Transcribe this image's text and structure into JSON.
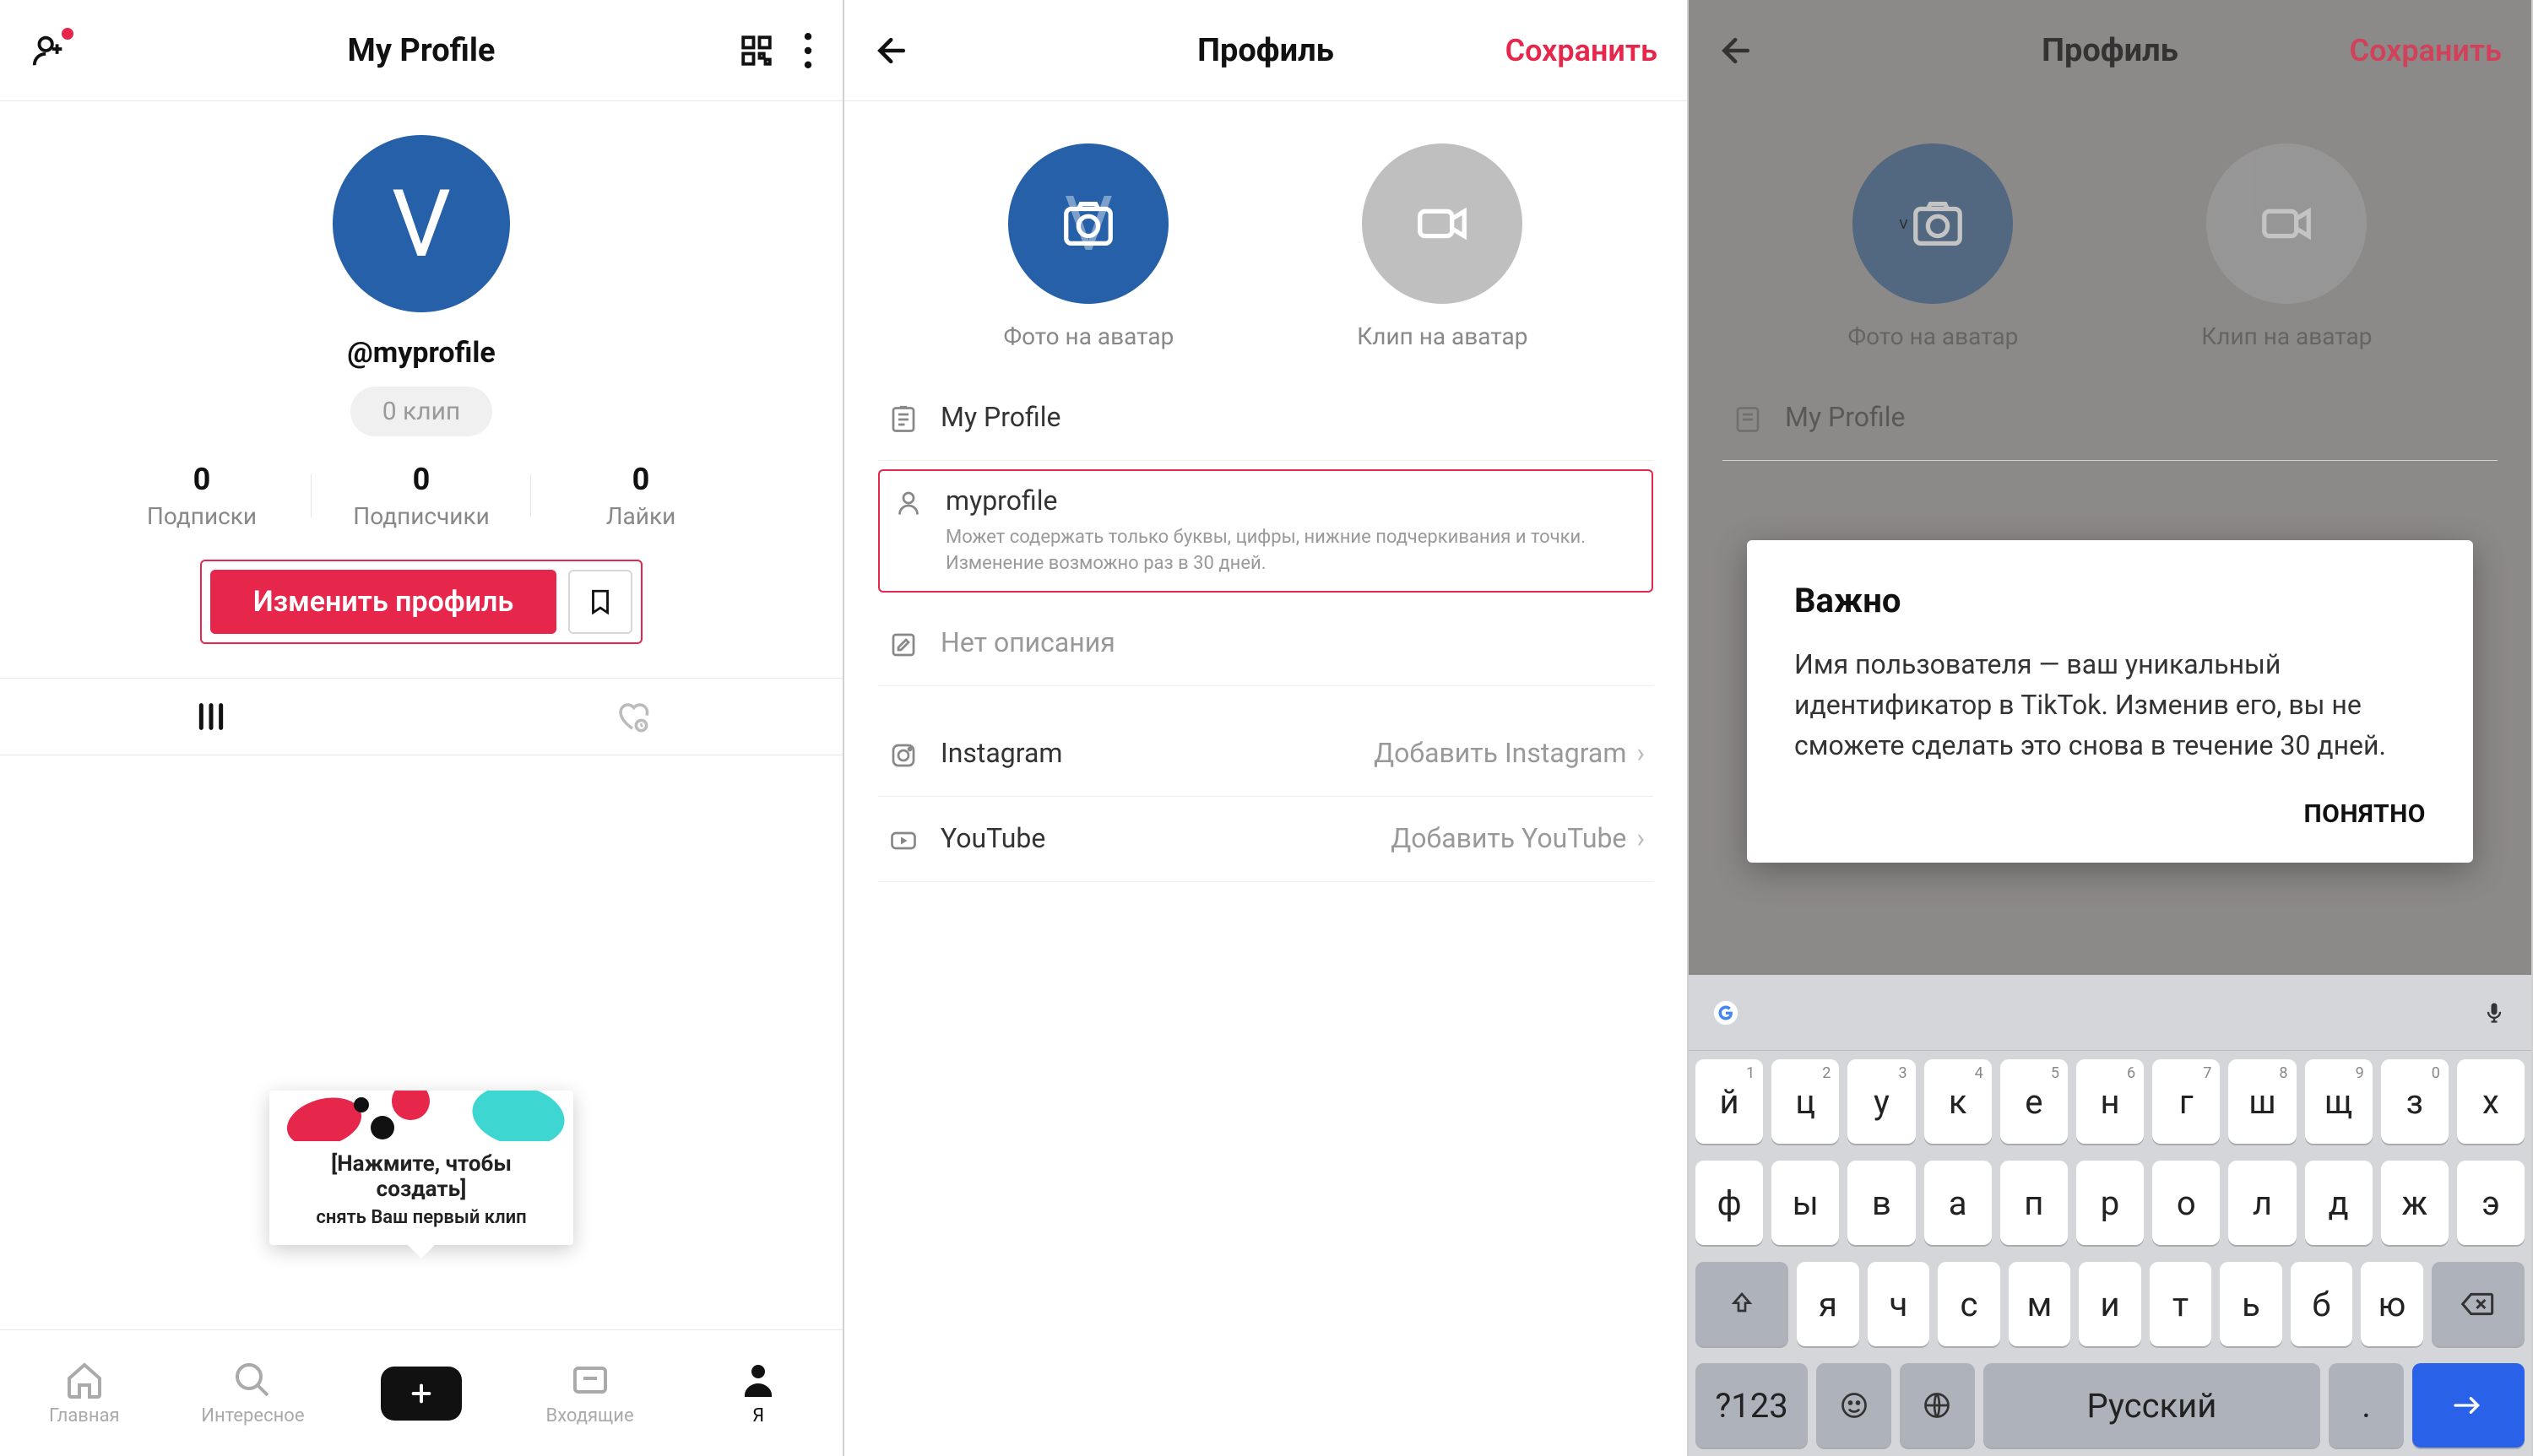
{
  "panel1": {
    "header": {
      "title": "My Profile"
    },
    "username": "@myprofile",
    "clip_pill": "0 клип",
    "stats": [
      {
        "n": "0",
        "l": "Подписки"
      },
      {
        "n": "0",
        "l": "Подписчики"
      },
      {
        "n": "0",
        "l": "Лайки"
      }
    ],
    "edit_btn": "Изменить профиль",
    "hint_title": "[Нажмите, чтобы создать]",
    "hint_sub": "снять Ваш первый клип",
    "nav": {
      "home": "Главная",
      "discover": "Интересное",
      "inbox": "Входящие",
      "me": "Я"
    }
  },
  "panel2": {
    "header": {
      "title": "Профиль",
      "save": "Сохранить"
    },
    "photo_label": "Фото на аватар",
    "video_label": "Клип на аватар",
    "rows": {
      "name": "My Profile",
      "username": "myprofile",
      "username_hint": "Может содержать только буквы, цифры, нижние подчеркивания и точки. Изменение возможно раз в 30 дней.",
      "bio_placeholder": "Нет описания",
      "instagram": "Instagram",
      "instagram_action": "Добавить Instagram",
      "youtube": "YouTube",
      "youtube_action": "Добавить YouTube"
    }
  },
  "panel3": {
    "header": {
      "title": "Профиль",
      "save": "Сохранить"
    },
    "photo_label": "Фото на аватар",
    "video_label": "Клип на аватар",
    "name_row": "My Profile",
    "dialog": {
      "title": "Важно",
      "body": "Имя пользователя — ваш уникальный идентификатор в TikTok. Изменив его, вы не сможете сделать это снова в течение 30 дней.",
      "ok": "ПОНЯТНО"
    },
    "keyboard": {
      "row1": [
        {
          "k": "й",
          "s": "1"
        },
        {
          "k": "ц",
          "s": "2"
        },
        {
          "k": "у",
          "s": "3"
        },
        {
          "k": "к",
          "s": "4"
        },
        {
          "k": "е",
          "s": "5"
        },
        {
          "k": "н",
          "s": "6"
        },
        {
          "k": "г",
          "s": "7"
        },
        {
          "k": "ш",
          "s": "8"
        },
        {
          "k": "щ",
          "s": "9"
        },
        {
          "k": "з",
          "s": "0"
        },
        {
          "k": "х",
          "s": ""
        }
      ],
      "row2": [
        "ф",
        "ы",
        "в",
        "а",
        "п",
        "р",
        "о",
        "л",
        "д",
        "ж",
        "э"
      ],
      "row3": [
        "я",
        "ч",
        "с",
        "м",
        "и",
        "т",
        "ь",
        "б",
        "ю"
      ],
      "sym": "?123",
      "lang": "Русский"
    }
  }
}
